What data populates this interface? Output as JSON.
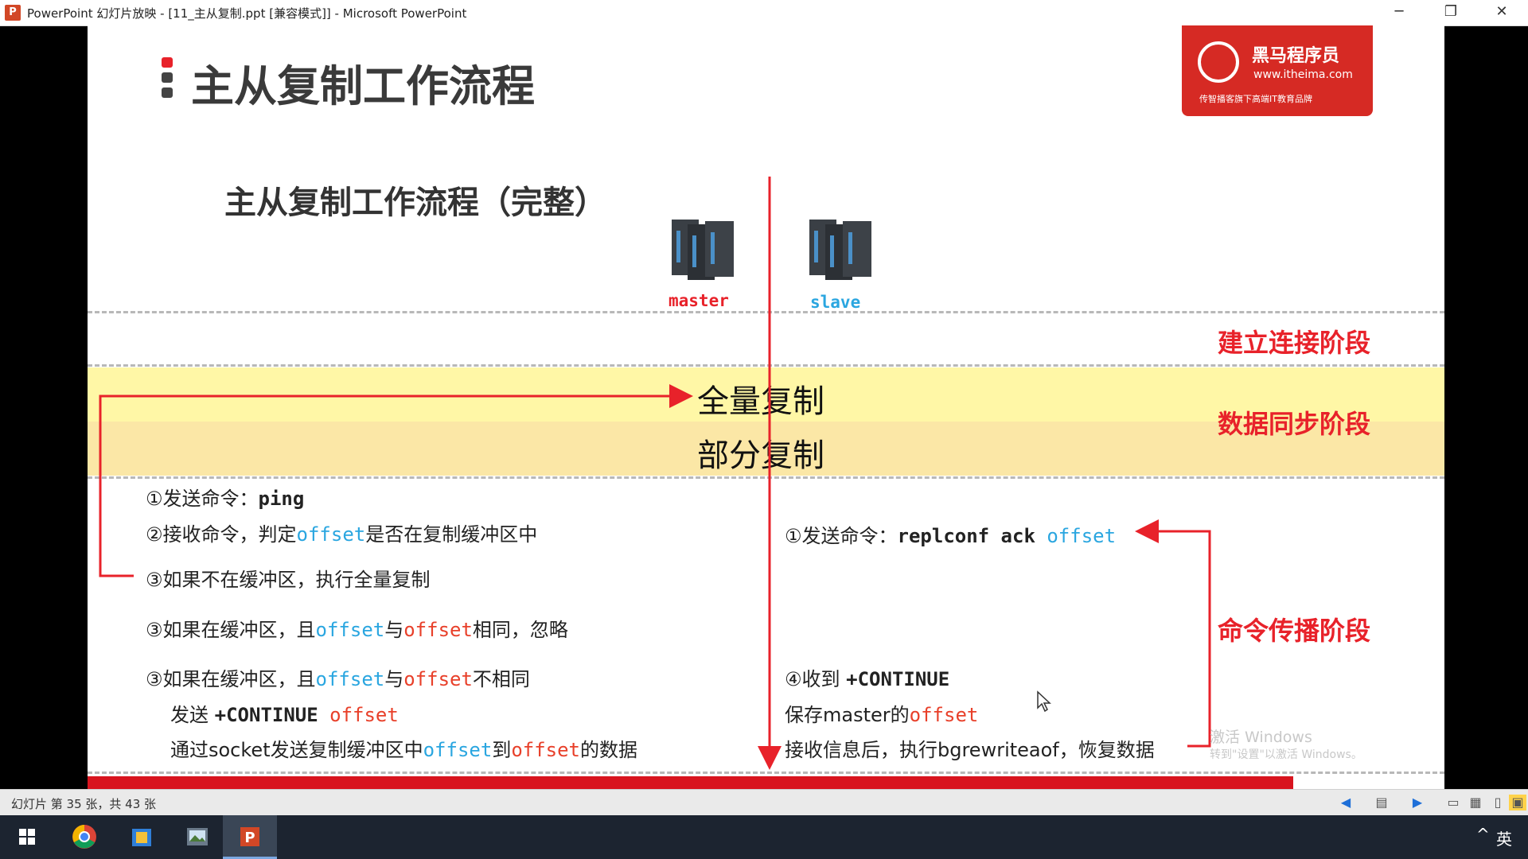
{
  "window": {
    "app_icon": "P",
    "title": "PowerPoint 幻灯片放映 - [11_主从复制.ppt [兼容模式]] - Microsoft PowerPoint",
    "controls": {
      "minimize": "─",
      "restore": "❐",
      "close": "✕"
    }
  },
  "slide": {
    "title": "主从复制工作流程",
    "subtitle": "主从复制工作流程（完整）",
    "logo": {
      "main": "黑马程序员",
      "url": "www.itheima.com",
      "tagline": "传智播客旗下高端IT教育品牌"
    },
    "servers": {
      "master": "master",
      "slave": "slave"
    },
    "bands": {
      "full_copy": "全量复制",
      "partial_copy": "部分复制"
    },
    "phases": {
      "connect": "建立连接阶段",
      "sync": "数据同步阶段",
      "propagate": "命令传播阶段"
    },
    "left": {
      "l1_prefix": "①发送命令：",
      "l1_cmd": "ping",
      "l2_prefix": "②接收命令，判定",
      "l2_offset": "offset",
      "l2_suffix": "是否在复制缓冲区中",
      "l3": "③如果不在缓冲区，执行全量复制",
      "l4_prefix": "③如果在缓冲区，且",
      "l4_off1": "offset",
      "l4_mid": "与",
      "l4_off2": "offset",
      "l4_suffix": "相同，忽略",
      "l5_prefix": "③如果在缓冲区，且",
      "l5_off1": "offset",
      "l5_mid": "与",
      "l5_off2": "offset",
      "l5_suffix": "不相同",
      "l6_prefix": "发送 ",
      "l6_cmd": "+CONTINUE",
      "l6_offset": " offset",
      "l7_prefix": "通过socket发送复制缓冲区中",
      "l7_off1": "offset",
      "l7_mid": "到",
      "l7_off2": "offset",
      "l7_suffix": "的数据"
    },
    "right": {
      "r1_prefix": "①发送命令：",
      "r1_cmd": "replconf ack ",
      "r1_offset": "offset",
      "r2_prefix": "④收到 ",
      "r2_cmd": "+CONTINUE",
      "r3_prefix": "保存master的",
      "r3_offset": "offset",
      "r4": "接收信息后，执行bgrewriteaof，恢复数据"
    }
  },
  "watermark": {
    "line1": "激活 Windows",
    "line2": "转到\"设置\"以激活 Windows。"
  },
  "statusbar": {
    "slide_counter": "幻灯片 第 35 张，共 43 张"
  },
  "taskbar": {
    "lang": "英",
    "tray": "^"
  },
  "colors": {
    "accent_red": "#e8222a",
    "offset_blue": "#2aa6e0",
    "band_yellow": "#fff7a6",
    "band_orange": "#fbe7a6"
  }
}
